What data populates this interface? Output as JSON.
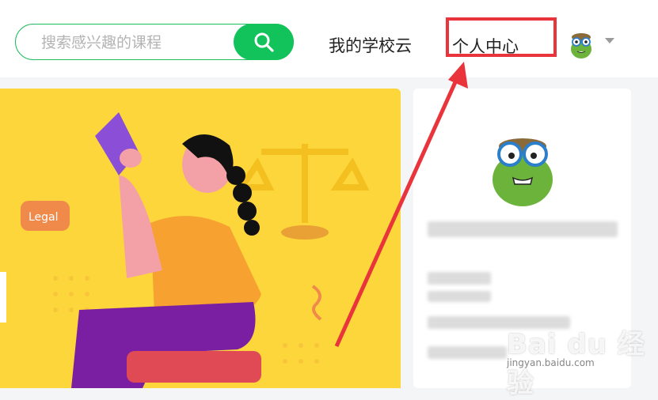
{
  "search": {
    "placeholder": "搜索感兴趣的课程"
  },
  "nav": {
    "school_label": "我的学校云",
    "personal_label": "个人中心"
  },
  "banner": {
    "speech_bubble": "Legal"
  },
  "watermark": {
    "brand": "Bai du 经验",
    "url": "jingyan.baidu.com"
  },
  "colors": {
    "accent": "#12c25a",
    "banner": "#fdd63b",
    "highlight": "#e8343a"
  }
}
